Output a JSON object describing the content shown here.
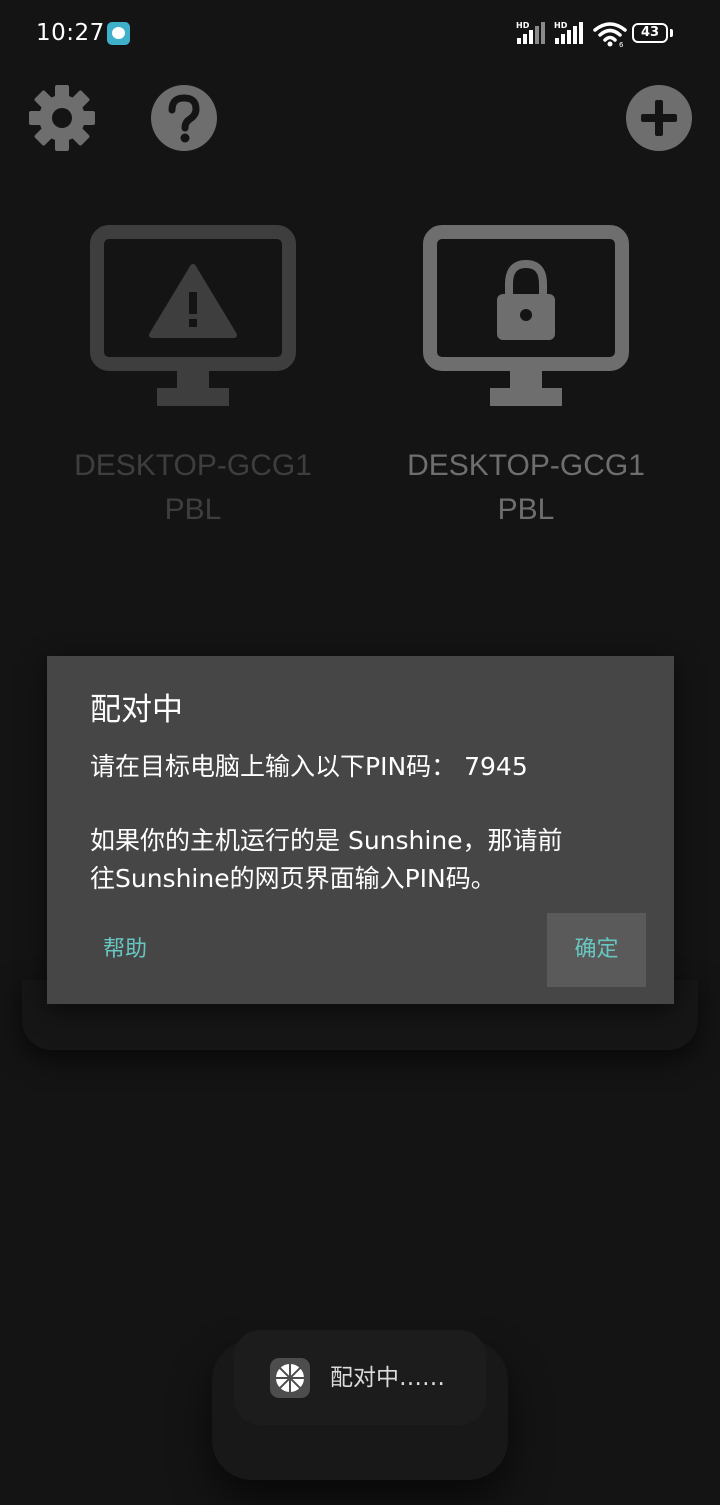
{
  "status_bar": {
    "time": "10:27",
    "signal_1_label": "HD",
    "signal_2_label": "HD",
    "battery": "43"
  },
  "toolbar": {
    "settings_icon": "gear-icon",
    "help_icon": "question-icon",
    "add_icon": "plus-icon"
  },
  "computers": [
    {
      "name": "DESKTOP-GCG1PBL",
      "state_icon": "warning-icon"
    },
    {
      "name": "DESKTOP-GCG1PBL",
      "state_icon": "lock-icon"
    }
  ],
  "dialog": {
    "title": "配对中",
    "message_line_1": "请在目标电脑上输入以下PIN码： 7945",
    "message_line_2": "如果你的主机运行的是 Sunshine，那请前",
    "message_line_3": "往Sunshine的网页界面输入PIN码。",
    "help_label": "帮助",
    "ok_label": "确定"
  },
  "toast": {
    "text": "配对中……"
  },
  "colors": {
    "background": "#141414",
    "dialog": "#464646",
    "accent": "#67c7c0",
    "icon_gray": "#6e6e6e",
    "dim_gray": "#3e3e3e"
  }
}
